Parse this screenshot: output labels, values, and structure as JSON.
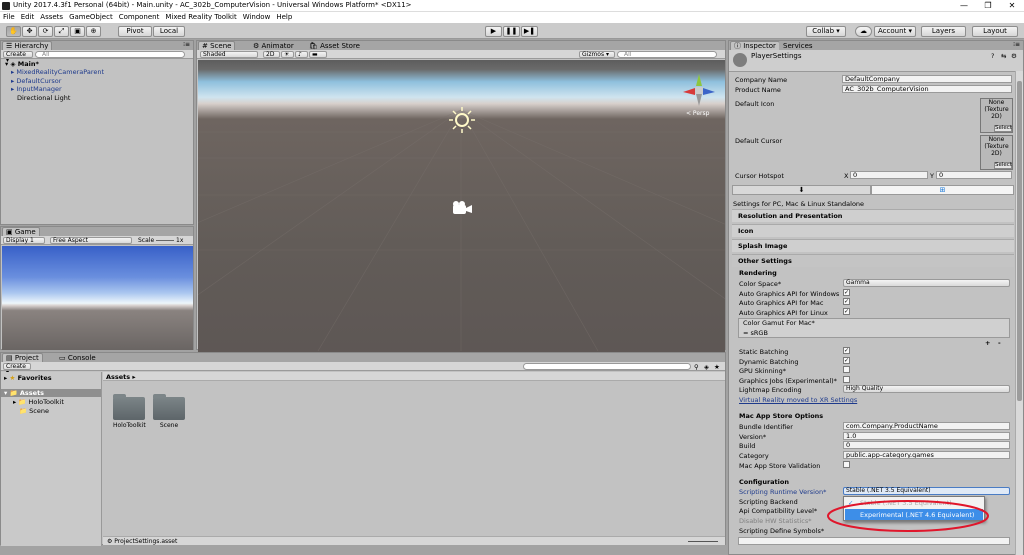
{
  "window": {
    "title": "Unity 2017.4.3f1 Personal (64bit) - Main.unity - AC_302b_ComputerVision - Universal Windows Platform* <DX11>",
    "minimize": "—",
    "maximize": "❐",
    "close": "✕"
  },
  "menu": [
    "File",
    "Edit",
    "Assets",
    "GameObject",
    "Component",
    "Mixed Reality Toolkit",
    "Window",
    "Help"
  ],
  "toolbar": {
    "pivot": "Pivot",
    "local": "Local",
    "play": "▶",
    "pause": "❚❚",
    "step": "▶❚",
    "collab": "Collab ▾",
    "account": "Account ▾",
    "layers": "Layers",
    "layout": "Layout"
  },
  "hierarchy": {
    "tab": "Hierarchy",
    "create": "Create ▾",
    "search_placeholder": "All",
    "scene_name": "Main*",
    "items": [
      "MixedRealityCameraParent",
      "DefaultCursor",
      "InputManager",
      "Directional Light"
    ]
  },
  "scene": {
    "tabs": [
      "Scene",
      "Animator",
      "Asset Store"
    ],
    "shading": "Shaded",
    "mode2d": "2D",
    "gizmos": "Gizmos ▾",
    "search_placeholder": "All",
    "persp": "< Persp"
  },
  "game": {
    "tab": "Game",
    "display": "Display 1",
    "aspect": "Free Aspect",
    "scale_label": "Scale",
    "scale_value": "1x"
  },
  "project": {
    "tabs": [
      "Project",
      "Console"
    ],
    "create": "Create ▾",
    "favorites": "Favorites",
    "assets_root": "Assets",
    "tree": [
      "HoloToolkit",
      "Scene"
    ],
    "breadcrumb": "Assets ▸",
    "folders": [
      "HoloToolkit",
      "Scene"
    ],
    "status_file": "ProjectSettings.asset"
  },
  "inspector": {
    "tabs": [
      "Inspector",
      "Services"
    ],
    "title": "PlayerSettings",
    "company_name_label": "Company Name",
    "company_name": "DefaultCompany",
    "product_name_label": "Product Name",
    "product_name": "AC_302b_ComputerVision",
    "default_icon_label": "Default Icon",
    "default_cursor_label": "Default Cursor",
    "texture_none": "None (Texture 2D)",
    "select": "Select",
    "cursor_hotspot_label": "Cursor Hotspot",
    "x_label": "X",
    "x_value": "0",
    "y_label": "Y",
    "y_value": "0",
    "platform_caption": "Settings for PC, Mac & Linux Standalone",
    "sections": [
      "Resolution and Presentation",
      "Icon",
      "Splash Image"
    ],
    "other_settings": "Other Settings",
    "rendering": "Rendering",
    "color_space_label": "Color Space*",
    "color_space": "Gamma",
    "auto_win": "Auto Graphics API for Windows",
    "auto_mac": "Auto Graphics API for Mac",
    "auto_linux": "Auto Graphics API for Linux",
    "gamut_label": "Color Gamut For Mac*",
    "gamut_item": "sRGB",
    "plus": "+",
    "minus": "-",
    "static_batching": "Static Batching",
    "dynamic_batching": "Dynamic Batching",
    "gpu_skinning": "GPU Skinning*",
    "graphics_jobs": "Graphics Jobs (Experimental)*",
    "lightmap_label": "Lightmap Encoding",
    "lightmap_value": "High Quality",
    "vr_link": "Virtual Reality moved to XR Settings",
    "mac_store": "Mac App Store Options",
    "bundle_id_label": "Bundle Identifier",
    "bundle_id": "com.Company.ProductName",
    "version_label": "Version*",
    "version": "1.0",
    "build_label": "Build",
    "build": "0",
    "category_label": "Category",
    "category": "public.app-category.games",
    "validation_label": "Mac App Store Validation",
    "configuration": "Configuration",
    "runtime_label": "Scripting Runtime Version*",
    "runtime_value": "Stable (.NET 3.5 Equivalent)",
    "backend_label": "Scripting Backend",
    "api_label": "Api Compatibility Level*",
    "hw_stats_label": "Disable HW Statistics*",
    "define_label": "Scripting Define Symbols*",
    "dropdown_options": [
      "Stable (.NET 3.5 Equivalent)",
      "Experimental (.NET 4.6 Equivalent)"
    ]
  },
  "colors": {
    "highlight": "#3d8ee8",
    "annotation": "#e0162b",
    "link": "#1e3a8c"
  }
}
